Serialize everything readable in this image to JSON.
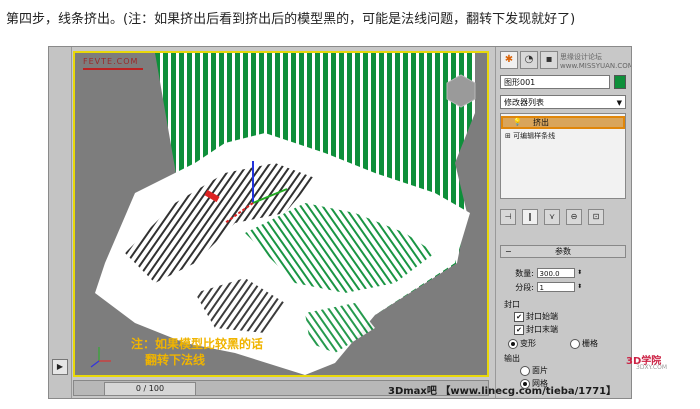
{
  "caption": "第四步，线条挤出。(注：如果挤出后看到挤出后的模型黑的，可能是法线问题，翻转下发现就好了)",
  "viewport": {
    "watermark": "FEVTE.COM",
    "note_line1": "注：如果模型比较黑的话",
    "note_line2": "翻转下法线"
  },
  "timeline": {
    "frame_label": "0 / 100"
  },
  "left_strip": {
    "play": "▶"
  },
  "panel": {
    "tabs": [
      "✱",
      "◔",
      "▪",
      "◎",
      "▭",
      "⚙"
    ],
    "watermark": "思缘设计论坛 www.MISSYUAN.COM",
    "object_name": "图形001",
    "object_color": "#0e8f3a",
    "modifier_list": "修改器列表",
    "stack_extrude": "挤出",
    "stack_spline": "可编辑样条线",
    "tools": [
      "⊣",
      "‖",
      "⋎",
      "⊖",
      "⊡"
    ],
    "params_title": "参数",
    "amount_label": "数量:",
    "amount_value": "300.0",
    "segments_label": "分段:",
    "segments_value": "1",
    "cap_group": "封口",
    "cap_start": "封口始端",
    "cap_end": "封口末端",
    "morph": "变形",
    "grid": "栅格",
    "output_group": "输出",
    "output_patch": "面片",
    "output_mesh": "网格"
  },
  "credit": "3Dmax吧 【www.linecg.com/tieba/1771】",
  "logo3d": "3D学院",
  "logo3d_sub": "3DXY.COM",
  "colors": {
    "accent_orange": "#e0860a",
    "viewport_border": "#e8d80a",
    "terrain_green": "#0e8f3a"
  }
}
